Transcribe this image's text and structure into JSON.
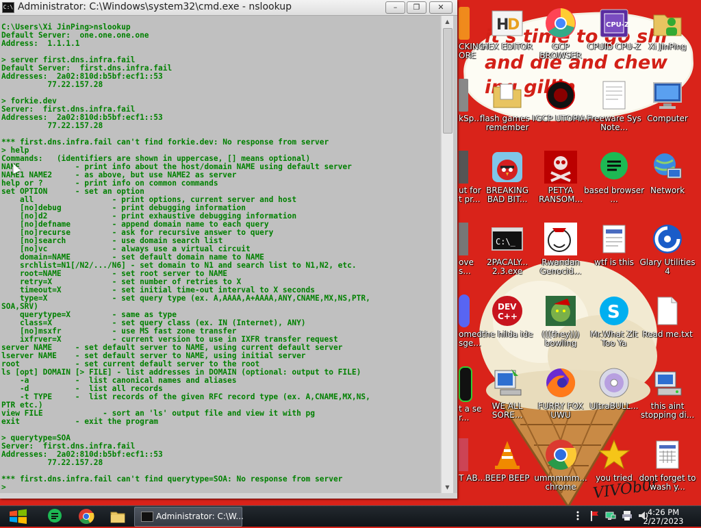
{
  "cmd_window": {
    "title": "Administrator: C:\\Windows\\system32\\cmd.exe - nslookup",
    "icon_label": "C:\\",
    "controls": {
      "minimize": "–",
      "maximize": "❐",
      "close": "✕"
    },
    "console_lines": [
      "C:\\Users\\Xi JinPing>nslookup",
      "Default Server:  one.one.one.one",
      "Address:  1.1.1.1",
      "",
      "> server first.dns.infra.fail",
      "Default Server:  first.dns.infra.fail",
      "Addresses:  2a02:810d:b5bf:ecf1::53",
      "          77.22.157.28",
      "",
      "> forkie.dev",
      "Server:  first.dns.infra.fail",
      "Addresses:  2a02:810d:b5bf:ecf1::53",
      "          77.22.157.28",
      "",
      "*** first.dns.infra.fail can't find forkie.dev: No response from server",
      "> help",
      "Commands:   (identifiers are shown in uppercase, [] means optional)",
      "NAME            - print info about the host/domain NAME using default server",
      "NAME1 NAME2     - as above, but use NAME2 as server",
      "help or ?       - print info on common commands",
      "set OPTION      - set an option",
      "    all                 - print options, current server and host",
      "    [no]debug           - print debugging information",
      "    [no]d2              - print exhaustive debugging information",
      "    [no]defname         - append domain name to each query",
      "    [no]recurse         - ask for recursive answer to query",
      "    [no]search          - use domain search list",
      "    [no]vc              - always use a virtual circuit",
      "    domain=NAME         - set default domain name to NAME",
      "    srchlist=N1[/N2/.../N6] - set domain to N1 and search list to N1,N2, etc.",
      "    root=NAME           - set root server to NAME",
      "    retry=X             - set number of retries to X",
      "    timeout=X           - set initial time-out interval to X seconds",
      "    type=X              - set query type (ex. A,AAAA,A+AAAA,ANY,CNAME,MX,NS,PTR,",
      "SOA,SRV)",
      "    querytype=X         - same as type",
      "    class=X             - set query class (ex. IN (Internet), ANY)",
      "    [no]msxfr           - use MS fast zone transfer",
      "    ixfrver=X           - current version to use in IXFR transfer request",
      "server NAME     - set default server to NAME, using current default server",
      "lserver NAME    - set default server to NAME, using initial server",
      "root            - set current default server to the root",
      "ls [opt] DOMAIN [> FILE] - list addresses in DOMAIN (optional: output to FILE)",
      "    -a          -  list canonical names and aliases",
      "    -d          -  list all records",
      "    -t TYPE     -  list records of the given RFC record type (ex. A,CNAME,MX,NS,",
      "PTR etc.)",
      "view FILE             - sort an 'ls' output file and view it with pg",
      "exit            - exit the program",
      "",
      "> querytype=SOA",
      "Server:  first.dns.infra.fail",
      "Addresses:  2a02:810d:b5bf:ecf1::53",
      "          77.22.157.28",
      "",
      "*** first.dns.infra.fail can't find querytype=SOA: No response from server",
      ">"
    ],
    "text_color": "#008000",
    "background_color": "#c0c0c0"
  },
  "desktop": {
    "background_color": "#d9231a",
    "meme_text": [
      "it's time to go shi",
      "and die and chew",
      "ing gillin"
    ],
    "signature": "VIVOb0t",
    "icons": [
      {
        "label": "CKING\nORE",
        "icon": "partial-orange-icon"
      },
      {
        "label": "HEX EDITOR",
        "icon": "hxd-icon"
      },
      {
        "label": "GCP BROWSER",
        "icon": "chromium-browser-icon"
      },
      {
        "label": "CPUID CPU-Z",
        "icon": "cpuz-icon"
      },
      {
        "label": "Xi JinPing",
        "icon": "user-folder-icon"
      },
      {
        "label": "kSp...",
        "icon": "partial-app-icon"
      },
      {
        "label": "flash games I remember",
        "icon": "folder-icon"
      },
      {
        "label": "GCP UTOPIA",
        "icon": "utopia-icon"
      },
      {
        "label": "Freeware Sys Note...",
        "icon": "text-document-icon"
      },
      {
        "label": "Computer",
        "icon": "computer-icon"
      },
      {
        "label": "ut for t pr...",
        "icon": "partial-app-icon"
      },
      {
        "label": "BREAKING BAD BIT...",
        "icon": "angry-birds-icon"
      },
      {
        "label": "PETYA RANSOM...",
        "icon": "skull-icon"
      },
      {
        "label": "based browser ...",
        "icon": "green-chat-icon"
      },
      {
        "label": "Network",
        "icon": "network-icon"
      },
      {
        "label": "ove s...",
        "icon": "partial-app-icon"
      },
      {
        "label": "2PACALY... 2.3.exe",
        "icon": "console-exe-icon"
      },
      {
        "label": "Rwandan Genocid...",
        "icon": "meme-face-icon"
      },
      {
        "label": "wtf is this",
        "icon": "document-icon"
      },
      {
        "label": "Glary Utilities 4",
        "icon": "glary-icon"
      },
      {
        "label": "omed sge...",
        "icon": "discord-icon"
      },
      {
        "label": "the hilda ide",
        "icon": "devcpp-icon"
      },
      {
        "label": "(((they))) bowling",
        "icon": "grinch-icon"
      },
      {
        "label": "Mr.What Zit Too Ya",
        "icon": "skype-icon"
      },
      {
        "label": "Read me.txt",
        "icon": "blank-document-icon"
      },
      {
        "label": "t a se r...",
        "icon": "partial-app-icon"
      },
      {
        "label": "WE ALL SORE...",
        "icon": "pc-setup-icon"
      },
      {
        "label": "FURRY FOX UWU",
        "icon": "firefox-icon"
      },
      {
        "label": "UltraBULL...",
        "icon": "cd-disc-icon"
      },
      {
        "label": "this aint stopping di...",
        "icon": "network-drive-icon"
      },
      {
        "label": "T AB...",
        "icon": "partial-app-icon"
      },
      {
        "label": "BEEP BEEP",
        "icon": "vlc-cone-icon"
      },
      {
        "label": "ummmmm... chrome",
        "icon": "chrome-icon"
      },
      {
        "label": "you tried",
        "icon": "gold-star-icon"
      },
      {
        "label": "dont forget to wash y...",
        "icon": "calendar-document-icon"
      }
    ]
  },
  "taskbar": {
    "pinned": [
      {
        "name": "green-chat-icon"
      },
      {
        "name": "chrome-icon"
      },
      {
        "name": "folder-icon"
      }
    ],
    "active_task": {
      "label": "Administrator: C:\\W...",
      "icon": "cmd-icon"
    },
    "tray_icons": [
      "show-hidden-icon",
      "flag-icon",
      "network-tray-icon",
      "printer-icon",
      "volume-icon"
    ],
    "clock": {
      "time": "4:26 PM",
      "date": "2/27/2023"
    }
  }
}
